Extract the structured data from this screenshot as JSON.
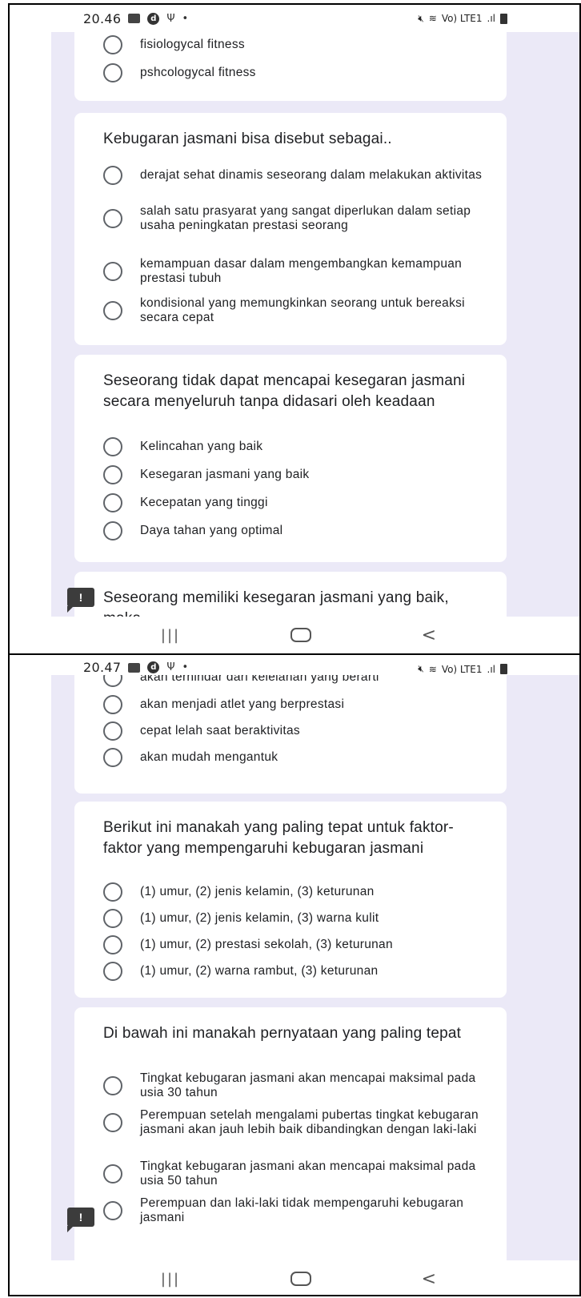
{
  "screen1": {
    "status": {
      "time": "20.46"
    },
    "q0": {
      "options": [
        "fisiologycal fitness",
        "pshcologycal fitness"
      ]
    },
    "q1": {
      "title": "Kebugaran jasmani bisa disebut sebagai..",
      "options": [
        "derajat sehat dinamis seseorang dalam melakukan aktivitas",
        "salah satu prasyarat yang sangat diperlukan dalam setiap usaha peningkatan prestasi seorang",
        "kemampuan dasar dalam mengembangkan kemampuan prestasi tubuh",
        "kondisional yang memungkinkan seorang untuk bereaksi secara cepat"
      ]
    },
    "q2": {
      "title": "Seseorang tidak dapat mencapai kesegaran jasmani secara menyeluruh tanpa didasari oleh keadaan",
      "options": [
        "Kelincahan yang baik",
        "Kesegaran jasmani yang baik",
        "Kecepatan yang tinggi",
        "Daya tahan yang optimal"
      ]
    },
    "q3": {
      "title": "Seseorang memiliki kesegaran jasmani yang baik, maka"
    }
  },
  "screen2": {
    "status": {
      "time": "20.47"
    },
    "q3": {
      "options": [
        "akan terhindar dari kelelahan yang berarti",
        "akan menjadi atlet yang berprestasi",
        "cepat lelah saat beraktivitas",
        "akan mudah mengantuk"
      ]
    },
    "q4": {
      "title": "Berikut ini manakah yang paling tepat untuk faktor-faktor yang mempengaruhi kebugaran jasmani",
      "options": [
        "(1) umur, (2) jenis kelamin, (3) keturunan",
        "(1) umur, (2) jenis kelamin, (3) warna kulit",
        "(1) umur, (2) prestasi sekolah, (3) keturunan",
        "(1) umur, (2) warna rambut, (3) keturunan"
      ]
    },
    "q5": {
      "title": "Di bawah ini manakah pernyataan yang paling tepat",
      "options": [
        "Tingkat kebugaran jasmani akan mencapai maksimal pada usia 30 tahun",
        "Perempuan setelah mengalami pubertas tingkat kebugaran jasmani akan jauh lebih baik dibandingkan dengan laki-laki",
        "Tingkat kebugaran jasmani akan mencapai maksimal pada usia 50 tahun",
        "Perempuan dan laki-laki tidak mempengaruhi kebugaran jasmani"
      ]
    }
  },
  "status_icons": {
    "network": "Vo) LTE1",
    "signal": ".ıl"
  },
  "feedback_icon_label": "!",
  "colors": {
    "background": "#ebe9f7",
    "card": "#ffffff",
    "radio": "#5f6368",
    "text": "#202124"
  }
}
